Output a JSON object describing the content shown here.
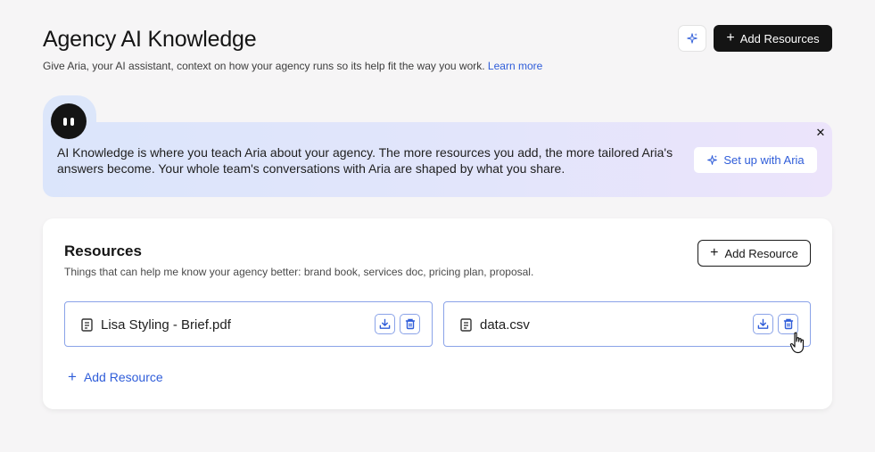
{
  "header": {
    "title": "Agency AI Knowledge",
    "subtitle": "Give Aria, your AI assistant, context on how your agency runs so its help fit the way you work.",
    "learn_more": "Learn more",
    "add_resources_label": "Add Resources",
    "ai_button_icon": "sparkle-icon"
  },
  "banner": {
    "text": "AI Knowledge is where you teach Aria about your agency. The more resources you add, the more tailored Aria's answers become. Your whole team's conversations with Aria are shaped by what you share.",
    "setup_label": "Set up with Aria",
    "close_label": "✕"
  },
  "resources": {
    "title": "Resources",
    "description": "Things that can help me know your agency better: brand book, services doc, pricing plan, proposal.",
    "add_button_label": "Add Resource",
    "add_link_label": "Add Resource",
    "files": [
      {
        "name": "Lisa Styling - Brief.pdf"
      },
      {
        "name": "data.csv"
      }
    ]
  },
  "colors": {
    "accent": "#2f5dd9",
    "primary_button": "#141414",
    "file_border": "#8aa3e8"
  }
}
